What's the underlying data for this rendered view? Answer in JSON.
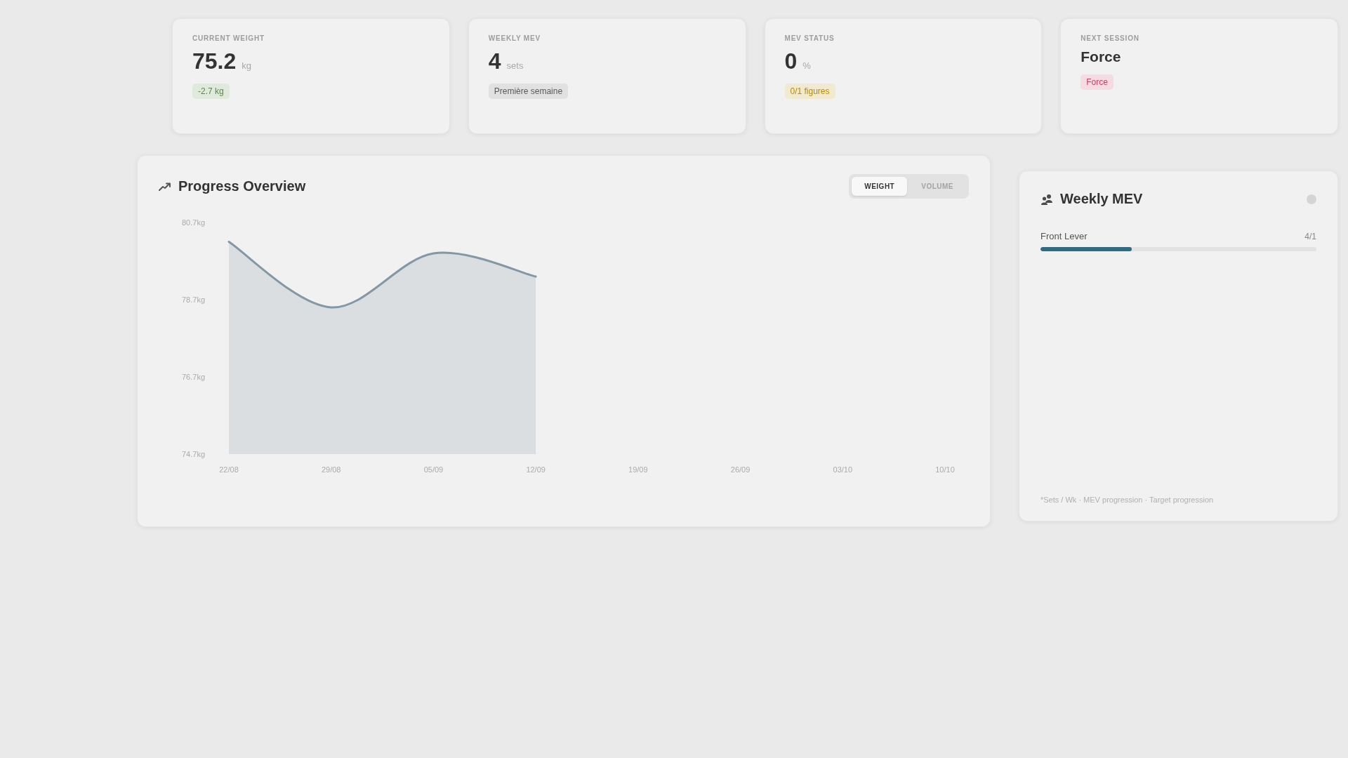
{
  "stat_cards": [
    {
      "kind": "metric",
      "label": "CURRENT WEIGHT",
      "value": "75.2",
      "unit": "kg",
      "badge": {
        "text": "-2.7 kg",
        "color": "#e0eadc"
      }
    },
    {
      "kind": "metric",
      "label": "WEEKLY MEV",
      "value": "4",
      "unit": "sets",
      "badge": {
        "text": "Première semaine",
        "color": "#e1e1e1"
      }
    },
    {
      "kind": "metric",
      "label": "MEV STATUS",
      "value": "0",
      "unit": "%",
      "badge": {
        "text": "0/1 figures",
        "color": "#f2ead0"
      }
    },
    {
      "kind": "text",
      "label": "NEXT SESSION",
      "value": "Force",
      "badge": {
        "text": "Force",
        "color": "#f5dce3"
      }
    }
  ],
  "progress_overview": {
    "title": "Progress Overview",
    "toggle": [
      {
        "label": "WEIGHT",
        "selected": true
      },
      {
        "label": "VOLUME",
        "selected": false
      }
    ],
    "chart_data": {
      "type": "area",
      "categories": [
        "22/08",
        "29/08",
        "05/09",
        "12/09",
        "19/09",
        "26/09",
        "03/10",
        "10/10"
      ],
      "series": [
        {
          "color": "#8398a5",
          "values": [
            80.2,
            78.5,
            79.9,
            79.3,
            null,
            null,
            null,
            null
          ]
        }
      ],
      "ylim": [
        74.7,
        80.7
      ],
      "yticks": [
        {
          "value": 80.7,
          "label": "80.7kg"
        },
        {
          "value": 78.7,
          "label": "78.7kg"
        },
        {
          "value": 76.7,
          "label": "76.7kg"
        },
        {
          "value": 74.7,
          "label": "74.7kg"
        }
      ]
    }
  },
  "weekly_mev": {
    "title": "Weekly MEV",
    "items": [
      {
        "name": "Front Lever",
        "count": "4/1",
        "level": 0.33
      }
    ],
    "footnote": "*Sets / Wk · MEV progression · Target progression"
  }
}
